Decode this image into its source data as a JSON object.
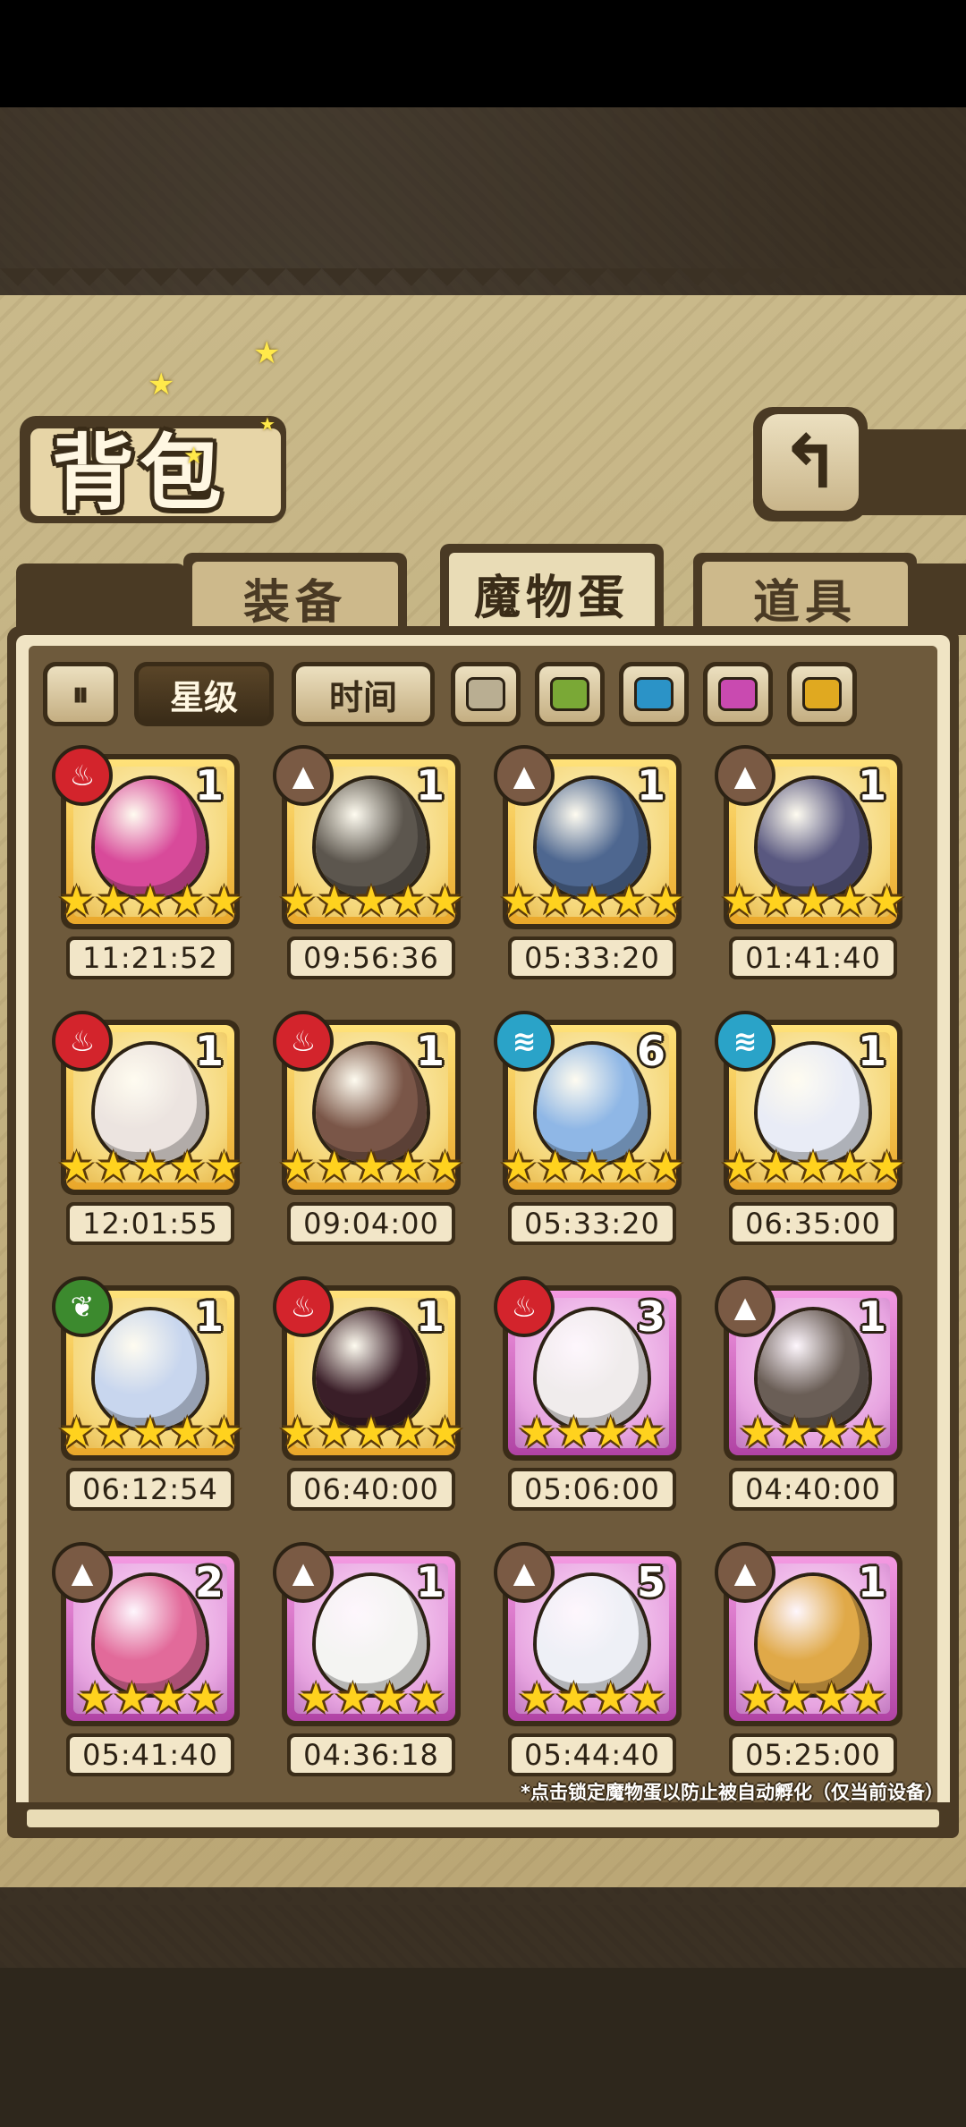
{
  "title": "背包",
  "back_icon": "back-arrow-icon",
  "tabs": [
    {
      "label": "装备",
      "active": false
    },
    {
      "label": "魔物蛋",
      "active": true
    },
    {
      "label": "道具",
      "active": false
    }
  ],
  "filters": {
    "sort_icon": "sort-order-icon",
    "star_label": "星级",
    "time_label": "时间",
    "colors": [
      "#b9ae92",
      "#7aa836",
      "#2b93c7",
      "#c94ab0",
      "#e0a920"
    ]
  },
  "eggs": [
    {
      "element": "fire",
      "count": "1",
      "stars": 5,
      "rarity": "gold",
      "time": "11:21:52",
      "egg_color": "#d84a9a"
    },
    {
      "element": "earth",
      "count": "1",
      "stars": 5,
      "rarity": "gold",
      "time": "09:56:36",
      "egg_color": "#5c564e"
    },
    {
      "element": "earth",
      "count": "1",
      "stars": 5,
      "rarity": "gold",
      "time": "05:33:20",
      "egg_color": "#4e6790"
    },
    {
      "element": "earth",
      "count": "1",
      "stars": 5,
      "rarity": "gold",
      "time": "01:41:40",
      "egg_color": "#595880"
    },
    {
      "element": "fire",
      "count": "1",
      "stars": 5,
      "rarity": "gold",
      "time": "12:01:55",
      "egg_color": "#ece4e0"
    },
    {
      "element": "fire",
      "count": "1",
      "stars": 5,
      "rarity": "gold",
      "time": "09:04:00",
      "egg_color": "#7a5648"
    },
    {
      "element": "water",
      "count": "6",
      "stars": 5,
      "rarity": "gold",
      "time": "05:33:20",
      "egg_color": "#8fb7e6"
    },
    {
      "element": "water",
      "count": "1",
      "stars": 5,
      "rarity": "gold",
      "time": "06:35:00",
      "egg_color": "#e9ecf6"
    },
    {
      "element": "nature",
      "count": "1",
      "stars": 5,
      "rarity": "gold",
      "time": "06:12:54",
      "egg_color": "#c8d6ee"
    },
    {
      "element": "fire",
      "count": "1",
      "stars": 5,
      "rarity": "gold",
      "time": "06:40:00",
      "egg_color": "#3a1e28"
    },
    {
      "element": "fire",
      "count": "3",
      "stars": 4,
      "rarity": "purple",
      "time": "05:06:00",
      "egg_color": "#f0ecec"
    },
    {
      "element": "earth",
      "count": "1",
      "stars": 4,
      "rarity": "purple",
      "time": "04:40:00",
      "egg_color": "#6a5e56"
    },
    {
      "element": "earth",
      "count": "2",
      "stars": 4,
      "rarity": "purple",
      "time": "05:41:40",
      "egg_color": "#e26a9a"
    },
    {
      "element": "earth",
      "count": "1",
      "stars": 4,
      "rarity": "purple",
      "time": "04:36:18",
      "egg_color": "#f4f4f2"
    },
    {
      "element": "earth",
      "count": "5",
      "stars": 4,
      "rarity": "purple",
      "time": "05:44:40",
      "egg_color": "#eef0f6"
    },
    {
      "element": "earth",
      "count": "1",
      "stars": 4,
      "rarity": "purple",
      "time": "05:25:00",
      "egg_color": "#e0a948"
    }
  ],
  "hint": "*点击锁定魔物蛋以防止被自动孵化（仅当前设备）"
}
